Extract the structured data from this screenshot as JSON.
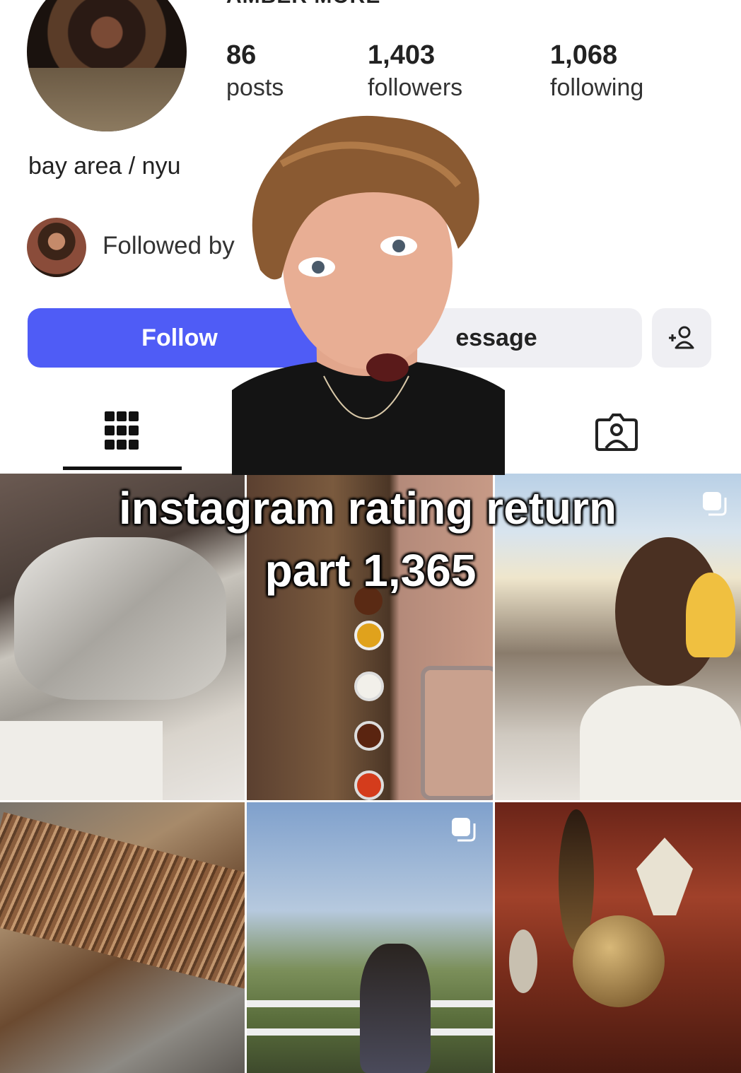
{
  "profile": {
    "name": "AMBER MORE",
    "bio": "bay area / nyu",
    "followed_by": "Followed by"
  },
  "stats": [
    {
      "value": "86",
      "label": "posts"
    },
    {
      "value": "1,403",
      "label": "followers"
    },
    {
      "value": "1,068",
      "label": "following"
    }
  ],
  "buttons": {
    "follow": "Follow",
    "message": "essage",
    "add_friend_icon": "add-person-icon"
  },
  "tabs": {
    "posts_icon": "grid-icon",
    "tagged_icon": "tagged-person-icon"
  },
  "caption": {
    "line1": "instagram rating return",
    "line2": "part 1,365"
  },
  "colors": {
    "follow_button": "#4f5cf6",
    "secondary_button": "#efeff3"
  }
}
